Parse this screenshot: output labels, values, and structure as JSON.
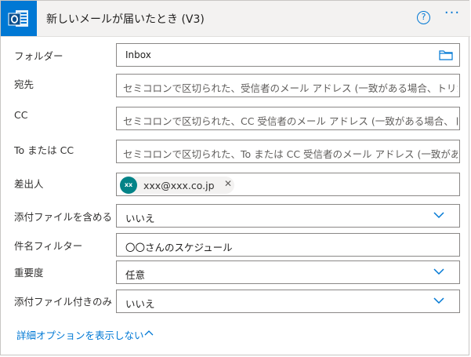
{
  "header": {
    "title": "新しいメールが届いたとき (V3)",
    "help": "?",
    "more": "···"
  },
  "fields": {
    "folder": {
      "label": "フォルダー",
      "value": "Inbox"
    },
    "to": {
      "label": "宛先",
      "placeholder": "セミコロンで区切られた、受信者のメール アドレス (一致がある場合、トリガーが実行されます)"
    },
    "cc": {
      "label": "CC",
      "placeholder": "セミコロンで区切られた、CC 受信者のメール アドレス (一致がある場合、トリガーが実行されます)"
    },
    "to_or_cc": {
      "label": "To または CC",
      "placeholder": "セミコロンで区切られた、To または CC 受信者のメール アドレス (一致がある場合、トリガーが実行されます)"
    },
    "from": {
      "label": "差出人",
      "chip_initials": "xx",
      "chip_value": "xxx@xxx.co.jp",
      "chip_remove": "✕"
    },
    "include_attachments": {
      "label": "添付ファイルを含める",
      "value": "いいえ"
    },
    "subject_filter": {
      "label": "件名フィルター",
      "value": "〇〇さんのスケジュール"
    },
    "importance": {
      "label": "重要度",
      "value": "任意"
    },
    "only_with_attachments": {
      "label": "添付ファイル付きのみ",
      "value": "いいえ"
    }
  },
  "advanced_link": "詳細オプションを表示しない",
  "colors": {
    "accent": "#0078d4",
    "chip_avatar": "#038387",
    "header_bg": "#f3f2f1"
  },
  "icons": [
    "outlook-icon",
    "help-icon",
    "more-icon",
    "folder-icon",
    "chevron-down-icon",
    "close-icon",
    "chevron-up-icon"
  ]
}
